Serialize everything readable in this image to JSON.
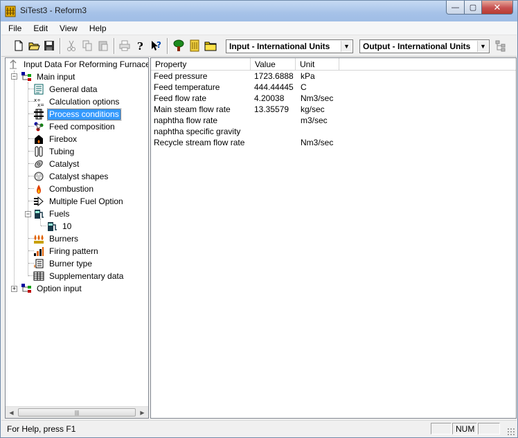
{
  "window": {
    "title": "SiTest3 - Reform3",
    "minimize_glyph": "—",
    "maximize_glyph": "▢",
    "close_glyph": "✕"
  },
  "menu": [
    "File",
    "Edit",
    "View",
    "Help"
  ],
  "toolbar": {
    "input_units": "Input - International Units",
    "output_units": "Output - International Units",
    "dropdown_glyph": "▼"
  },
  "tree": {
    "root": "Input Data For Reforming Furnace",
    "main_input": "Main input",
    "items": [
      {
        "label": "General data",
        "icon": "document-list-icon"
      },
      {
        "label": "Calculation options",
        "icon": "calculator-icon"
      },
      {
        "label": "Process conditions",
        "icon": "valve-icon",
        "selected": true
      },
      {
        "label": "Feed composition",
        "icon": "molecule-icon"
      },
      {
        "label": "Firebox",
        "icon": "firebox-icon"
      },
      {
        "label": "Tubing",
        "icon": "tubing-icon"
      },
      {
        "label": "Catalyst",
        "icon": "catalyst-icon"
      },
      {
        "label": "Catalyst shapes",
        "icon": "catalyst-shapes-icon"
      },
      {
        "label": "Combustion",
        "icon": "flame-icon"
      },
      {
        "label": "Multiple Fuel Option",
        "icon": "multi-fuel-icon"
      }
    ],
    "fuels": {
      "label": "Fuels",
      "child": "10"
    },
    "items_after": [
      {
        "label": "Burners",
        "icon": "burners-icon"
      },
      {
        "label": "Firing pattern",
        "icon": "bar-chart-icon"
      },
      {
        "label": "Burner type",
        "icon": "burner-type-icon"
      },
      {
        "label": "Supplementary data",
        "icon": "table-icon"
      }
    ],
    "option_input": "Option input",
    "expand_glyph": "+",
    "collapse_glyph": "−",
    "scroll_left": "◀",
    "scroll_right": "▶",
    "scroll_thumb_grip": "|||"
  },
  "grid": {
    "headers": [
      "Property",
      "Value",
      "Unit"
    ],
    "rows": [
      {
        "property": "Feed pressure",
        "value": "1723.6888",
        "unit": "kPa"
      },
      {
        "property": "Feed temperature",
        "value": "444.44445",
        "unit": "C"
      },
      {
        "property": "Feed flow rate",
        "value": "4.20038",
        "unit": "Nm3/sec"
      },
      {
        "property": "Main steam flow rate",
        "value": "13.35579",
        "unit": "kg/sec"
      },
      {
        "property": "naphtha flow rate",
        "value": "",
        "unit": "m3/sec"
      },
      {
        "property": "naphtha specific gravity",
        "value": "",
        "unit": ""
      },
      {
        "property": "Recycle stream flow rate",
        "value": "",
        "unit": "Nm3/sec"
      }
    ]
  },
  "status": {
    "help": "For Help, press F1",
    "num": "NUM"
  },
  "colors": {
    "selection": "#3399ff",
    "title_gradient": "#a6c2e8",
    "close_button": "#c75050"
  }
}
